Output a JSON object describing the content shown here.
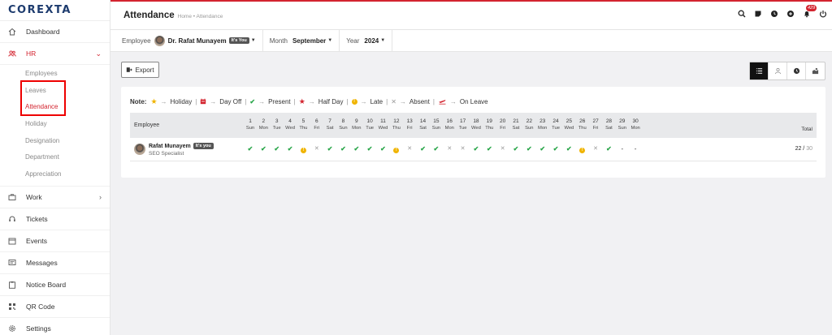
{
  "app": {
    "logo": "COREXTA"
  },
  "sidebar": {
    "items": [
      {
        "label": "Dashboard",
        "icon": "home-icon"
      },
      {
        "label": "HR",
        "icon": "users-icon",
        "active": true
      },
      {
        "label": "Work",
        "icon": "briefcase-icon"
      },
      {
        "label": "Tickets",
        "icon": "headset-icon"
      },
      {
        "label": "Events",
        "icon": "calendar-icon"
      },
      {
        "label": "Messages",
        "icon": "message-icon"
      },
      {
        "label": "Notice Board",
        "icon": "clipboard-icon"
      },
      {
        "label": "QR Code",
        "icon": "qr-icon"
      },
      {
        "label": "Settings",
        "icon": "gear-icon"
      }
    ],
    "hr_sub": [
      "Employees",
      "Leaves",
      "Attendance",
      "Holiday",
      "Designation",
      "Department",
      "Appreciation"
    ]
  },
  "header": {
    "title": "Attendance",
    "breadcrumb": "Home • Attendance",
    "notification_count": "429"
  },
  "filters": {
    "employee_label": "Employee",
    "employee_value": "Dr. Rafat Munayem",
    "its_you": "It's You",
    "month_label": "Month",
    "month_value": "September",
    "year_label": "Year",
    "year_value": "2024"
  },
  "toolbar": {
    "export_label": "Export"
  },
  "legend": {
    "note": "Note:",
    "holiday": "Holiday",
    "day_off": "Day Off",
    "present": "Present",
    "half_day": "Half Day",
    "late": "Late",
    "absent": "Absent",
    "on_leave": "On Leave"
  },
  "table": {
    "employee_header": "Employee",
    "total_header": "Total",
    "days": [
      {
        "n": "1",
        "w": "Sun"
      },
      {
        "n": "2",
        "w": "Mon"
      },
      {
        "n": "3",
        "w": "Tue"
      },
      {
        "n": "4",
        "w": "Wed"
      },
      {
        "n": "5",
        "w": "Thu"
      },
      {
        "n": "6",
        "w": "Fri"
      },
      {
        "n": "7",
        "w": "Sat"
      },
      {
        "n": "8",
        "w": "Sun"
      },
      {
        "n": "9",
        "w": "Mon"
      },
      {
        "n": "10",
        "w": "Tue"
      },
      {
        "n": "11",
        "w": "Wed"
      },
      {
        "n": "12",
        "w": "Thu"
      },
      {
        "n": "13",
        "w": "Fri"
      },
      {
        "n": "14",
        "w": "Sat"
      },
      {
        "n": "15",
        "w": "Sun"
      },
      {
        "n": "16",
        "w": "Mon"
      },
      {
        "n": "17",
        "w": "Tue"
      },
      {
        "n": "18",
        "w": "Wed"
      },
      {
        "n": "19",
        "w": "Thu"
      },
      {
        "n": "20",
        "w": "Fri"
      },
      {
        "n": "21",
        "w": "Sat"
      },
      {
        "n": "22",
        "w": "Sun"
      },
      {
        "n": "23",
        "w": "Mon"
      },
      {
        "n": "24",
        "w": "Tue"
      },
      {
        "n": "25",
        "w": "Wed"
      },
      {
        "n": "26",
        "w": "Thu"
      },
      {
        "n": "27",
        "w": "Fri"
      },
      {
        "n": "28",
        "w": "Sat"
      },
      {
        "n": "29",
        "w": "Sun"
      },
      {
        "n": "30",
        "w": "Mon"
      }
    ],
    "rows": [
      {
        "name": "Rafat Munayem",
        "tag": "It's you",
        "role": "SEO Specialist",
        "status": [
          "present",
          "present",
          "present",
          "present",
          "late",
          "absent",
          "present",
          "present",
          "present",
          "present",
          "present",
          "late",
          "absent",
          "present",
          "present",
          "absent",
          "absent",
          "present",
          "present",
          "absent",
          "present",
          "present",
          "present",
          "present",
          "present",
          "late",
          "absent",
          "present",
          "dash",
          "dash"
        ],
        "present": "22",
        "total": "30"
      }
    ]
  },
  "colors": {
    "accent": "#d3242f",
    "present": "#2aa64a",
    "late": "#f0b400",
    "absent": "#999999"
  }
}
